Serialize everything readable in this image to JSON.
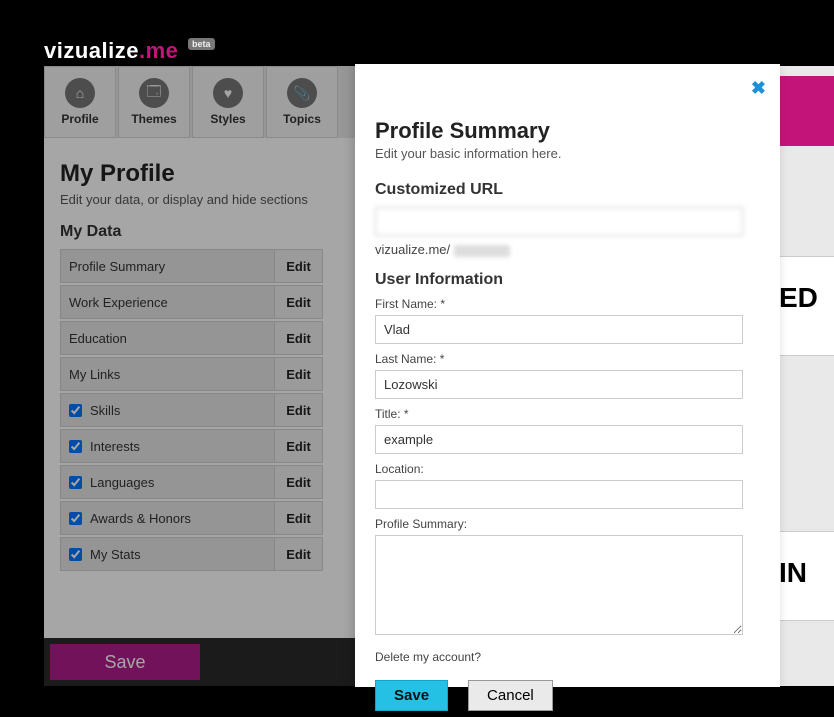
{
  "brand": {
    "part1": "vizualize",
    "part2": ".me",
    "badge": "beta"
  },
  "nav": {
    "tabs": [
      {
        "label": "Profile",
        "icon": "⌂"
      },
      {
        "label": "Themes",
        "icon": "🗔"
      },
      {
        "label": "Styles",
        "icon": "♥"
      },
      {
        "label": "Topics",
        "icon": "📎"
      }
    ],
    "scroll_glyph": "‹"
  },
  "page": {
    "title": "My Profile",
    "subtitle": "Edit your data, or display and hide sections",
    "section": "My Data",
    "edit_label": "Edit",
    "rows": [
      {
        "label": "Profile Summary",
        "checkbox": false
      },
      {
        "label": "Work Experience",
        "checkbox": false
      },
      {
        "label": "Education",
        "checkbox": false
      },
      {
        "label": "My Links",
        "checkbox": false
      },
      {
        "label": "Skills",
        "checkbox": true,
        "checked": true
      },
      {
        "label": "Interests",
        "checkbox": true,
        "checked": true
      },
      {
        "label": "Languages",
        "checkbox": true,
        "checked": true
      },
      {
        "label": "Awards & Honors",
        "checkbox": true,
        "checked": true
      },
      {
        "label": "My Stats",
        "checkbox": true,
        "checked": true
      }
    ]
  },
  "bottom": {
    "save": "Save",
    "cancel": "Cancel"
  },
  "modal": {
    "close_glyph": "✖",
    "title": "Profile Summary",
    "subtitle": "Edit your basic information here.",
    "url_section": "Customized URL",
    "url_value": "      ",
    "url_prefix": "vizualize.me/ ",
    "info_section": "User Information",
    "labels": {
      "first": "First Name: *",
      "last": "Last Name: *",
      "title": "Title: *",
      "location": "Location:",
      "summary": "Profile Summary:"
    },
    "values": {
      "first": "Vlad",
      "last": "Lozowski",
      "title": "example",
      "location": "",
      "summary": ""
    },
    "delete": "Delete my account?",
    "save": "Save",
    "cancel": "Cancel"
  },
  "sliver": {
    "frag1": "ED",
    "frag2": "IN"
  }
}
